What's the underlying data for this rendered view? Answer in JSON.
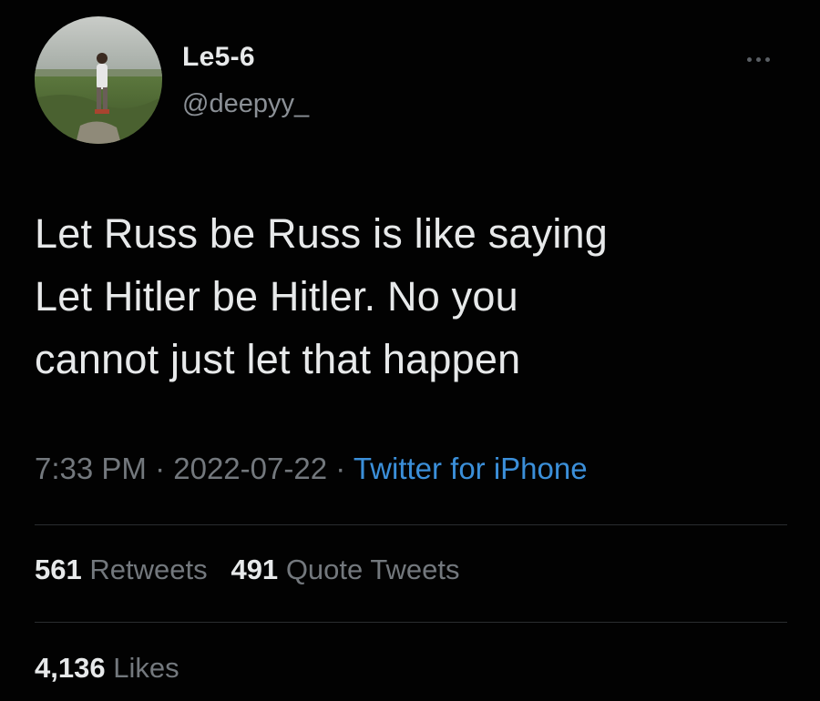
{
  "author": {
    "display_name": "Le5-6",
    "handle": "@deepyy_"
  },
  "tweet": {
    "text_lines": [
      "Let Russ be Russ is like saying",
      "Let Hitler be Hitler. No you",
      "cannot just let that happen"
    ]
  },
  "meta": {
    "time": "7:33 PM",
    "separator": "·",
    "date": "2022-07-22",
    "source": "Twitter for iPhone"
  },
  "stats": {
    "retweets_count": "561",
    "retweets_label": "Retweets",
    "quotes_count": "491",
    "quotes_label": "Quote Tweets",
    "likes_count": "4,136",
    "likes_label": "Likes"
  },
  "icons": {
    "more": "more-horizontal-icon",
    "avatar": "profile-photo"
  },
  "colors": {
    "background": "#020202",
    "text": "#e7e9ea",
    "secondary": "#73787d",
    "link": "#3b8fd9",
    "divider": "#2a2d30"
  }
}
